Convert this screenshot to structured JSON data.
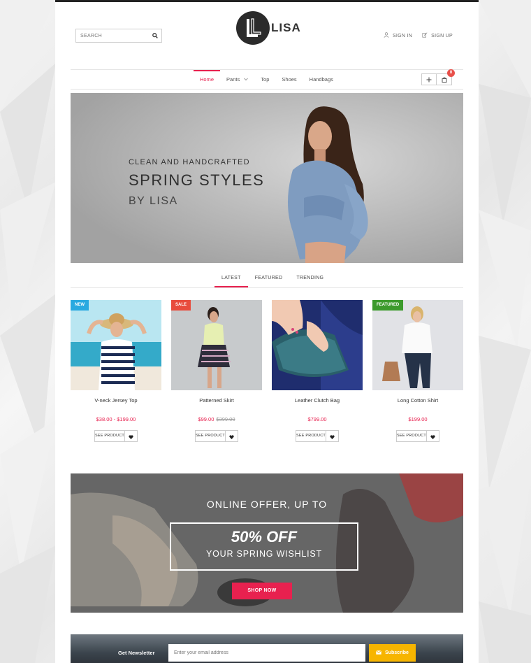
{
  "header": {
    "search_placeholder": "SEARCH",
    "logo_text": "LISA",
    "sign_in": "SIGN IN",
    "sign_up": "SIGN UP"
  },
  "nav": {
    "items": [
      {
        "label": "Home",
        "active": true
      },
      {
        "label": "Pants",
        "has_dropdown": true
      },
      {
        "label": "Top"
      },
      {
        "label": "Shoes"
      },
      {
        "label": "Handbags"
      }
    ],
    "cart_count": "0"
  },
  "hero": {
    "line1": "CLEAN AND HANDCRAFTED",
    "line2": "SPRING STYLES",
    "line3": "BY LISA"
  },
  "tabs": [
    {
      "label": "LATEST",
      "active": true
    },
    {
      "label": "FEATURED"
    },
    {
      "label": "TRENDING"
    }
  ],
  "products": [
    {
      "name": "V-neck Jersey Top",
      "price": "$38.00 - $199.00",
      "old_price": "",
      "badge": "NEW",
      "badge_color": "#29a9e0",
      "see_label": "SEE PRODUCT"
    },
    {
      "name": "Patterned Skirt",
      "price": "$99.00",
      "old_price": "$399.00",
      "badge": "SALE",
      "badge_color": "#e84c3d",
      "see_label": "SEE PRODUCT"
    },
    {
      "name": "Leather Clutch Bag",
      "price": "$799.00",
      "old_price": "",
      "badge": "",
      "badge_color": "",
      "see_label": "SEE PRODUCT"
    },
    {
      "name": "Long Cotton Shirt",
      "price": "$199.00",
      "old_price": "",
      "badge": "FEATURED",
      "badge_color": "#3c9a2c",
      "see_label": "SEE PRODUCT"
    }
  ],
  "offer": {
    "line1": "ONLINE OFFER, UP TO",
    "percent": "50% OFF",
    "line3": "YOUR SPRING WISHLIST",
    "button": "SHOP NOW"
  },
  "newsletter": {
    "label": "Get Newsletter",
    "placeholder": "Enter your email address",
    "button": "Subscribe"
  },
  "colors": {
    "accent": "#e8214f",
    "subscribe": "#f7b500"
  }
}
